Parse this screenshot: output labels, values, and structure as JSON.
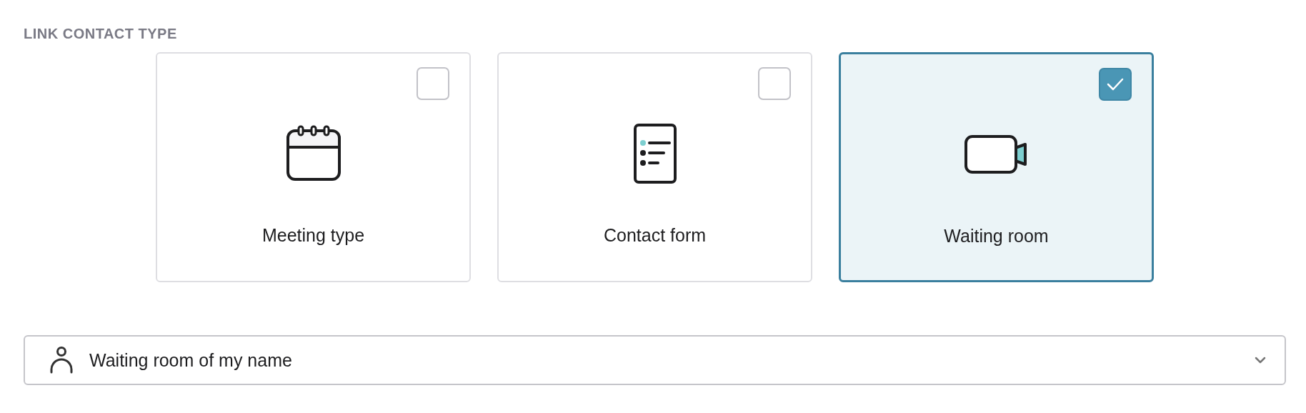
{
  "section_label": "LINK CONTACT TYPE",
  "options": [
    {
      "label": "Meeting type",
      "kind": "calendar",
      "selected": false
    },
    {
      "label": "Contact form",
      "kind": "form",
      "selected": false
    },
    {
      "label": "Waiting room",
      "kind": "video",
      "selected": true
    }
  ],
  "dropdown": {
    "value": "Waiting room of my name"
  }
}
